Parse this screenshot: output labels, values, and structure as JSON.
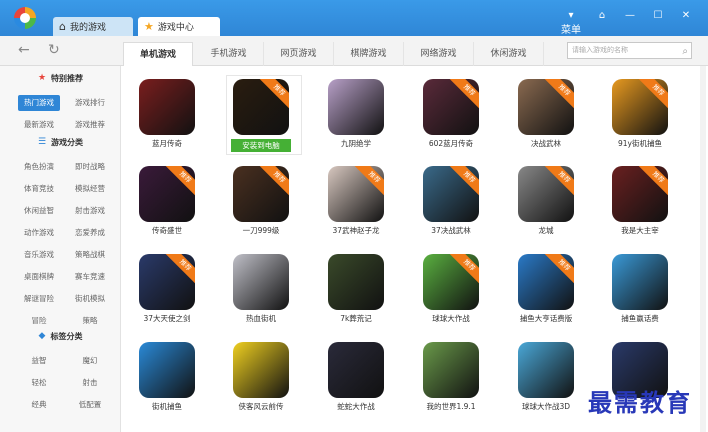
{
  "tabs": [
    {
      "label": "我的游戏",
      "icon": "home-icon"
    },
    {
      "label": "游戏中心",
      "icon": "star-icon"
    }
  ],
  "window": {
    "menu_label": "菜单",
    "menu_icon": "menu-icon"
  },
  "nav": {
    "back": "←",
    "refresh": "↻"
  },
  "categories": [
    "单机游戏",
    "手机游戏",
    "网页游戏",
    "棋牌游戏",
    "网络游戏",
    "休闲游戏"
  ],
  "active_category": "单机游戏",
  "search": {
    "placeholder": "请输入游戏的名称"
  },
  "sidebar": {
    "sections": [
      {
        "title": "特别推荐",
        "icon": "star-icon",
        "tags": [
          "热门游戏",
          "游戏排行",
          "最新游戏",
          "游戏推荐"
        ]
      },
      {
        "title": "游戏分类",
        "icon": "list-icon",
        "tags": [
          "角色扮演",
          "即时战略",
          "体育竞技",
          "模拟经营",
          "休闲益智",
          "射击游戏",
          "动作游戏",
          "恋爱养成",
          "音乐游戏",
          "策略战棋",
          "桌面棋牌",
          "赛车竞速",
          "解谜冒险",
          "街机模拟",
          "冒险",
          "策略"
        ]
      },
      {
        "title": "标签分类",
        "icon": "tag-icon",
        "tags": [
          "益智",
          "魔幻",
          "轻松",
          "射击",
          "经典",
          "低配置"
        ]
      }
    ],
    "active_tag": "热门游戏"
  },
  "badge_text": "推荐",
  "install_label": "安装到电脑",
  "games": [
    {
      "name": "蓝月传奇",
      "color": "#7a1e1e",
      "badge": false
    },
    {
      "name": "",
      "color": "#2a1d10",
      "badge": true,
      "installed_button": true
    },
    {
      "name": "九阴绝学",
      "color": "#b8a0c8",
      "badge": false
    },
    {
      "name": "602蓝月传奇",
      "color": "#5a2a3a",
      "badge": true
    },
    {
      "name": "决战武林",
      "color": "#8a6a50",
      "badge": true
    },
    {
      "name": "91y街机捕鱼",
      "color": "#e89a20",
      "badge": true
    },
    {
      "name": "传奇盛世",
      "color": "#3a1a3a",
      "badge": true
    },
    {
      "name": "一刀999级",
      "color": "#4a3020",
      "badge": true
    },
    {
      "name": "37武神赵子龙",
      "color": "#d8c8c0",
      "badge": true
    },
    {
      "name": "37决战武林",
      "color": "#3a6a8a",
      "badge": true
    },
    {
      "name": "龙城",
      "color": "#888888",
      "badge": true
    },
    {
      "name": "我是大主宰",
      "color": "#6a2020",
      "badge": true
    },
    {
      "name": "37大天使之剑",
      "color": "#2a3a6a",
      "badge": true
    },
    {
      "name": "热血街机",
      "color": "#c0c0c8",
      "badge": false
    },
    {
      "name": "7k葬荒记",
      "color": "#3a4a2a",
      "badge": false
    },
    {
      "name": "球球大作战",
      "color": "#5ab040",
      "badge": true
    },
    {
      "name": "捕鱼大亨话费版",
      "color": "#2a7ac8",
      "badge": true
    },
    {
      "name": "捕鱼赢话费",
      "color": "#3a9ad8",
      "badge": false
    },
    {
      "name": "街机捕鱼",
      "color": "#2a8ad8",
      "badge": false
    },
    {
      "name": "侠客风云前传",
      "color": "#f0d020",
      "badge": false
    },
    {
      "name": "蛇蛇大作战",
      "color": "#2a2a3a",
      "badge": false
    },
    {
      "name": "我的世界1.9.1",
      "color": "#6a9a4a",
      "badge": false
    },
    {
      "name": "球球大作战3D",
      "color": "#4aa8d8",
      "badge": false
    },
    {
      "name": "",
      "color": "#2a3a6a",
      "badge": false
    }
  ],
  "watermark": "最需教育"
}
